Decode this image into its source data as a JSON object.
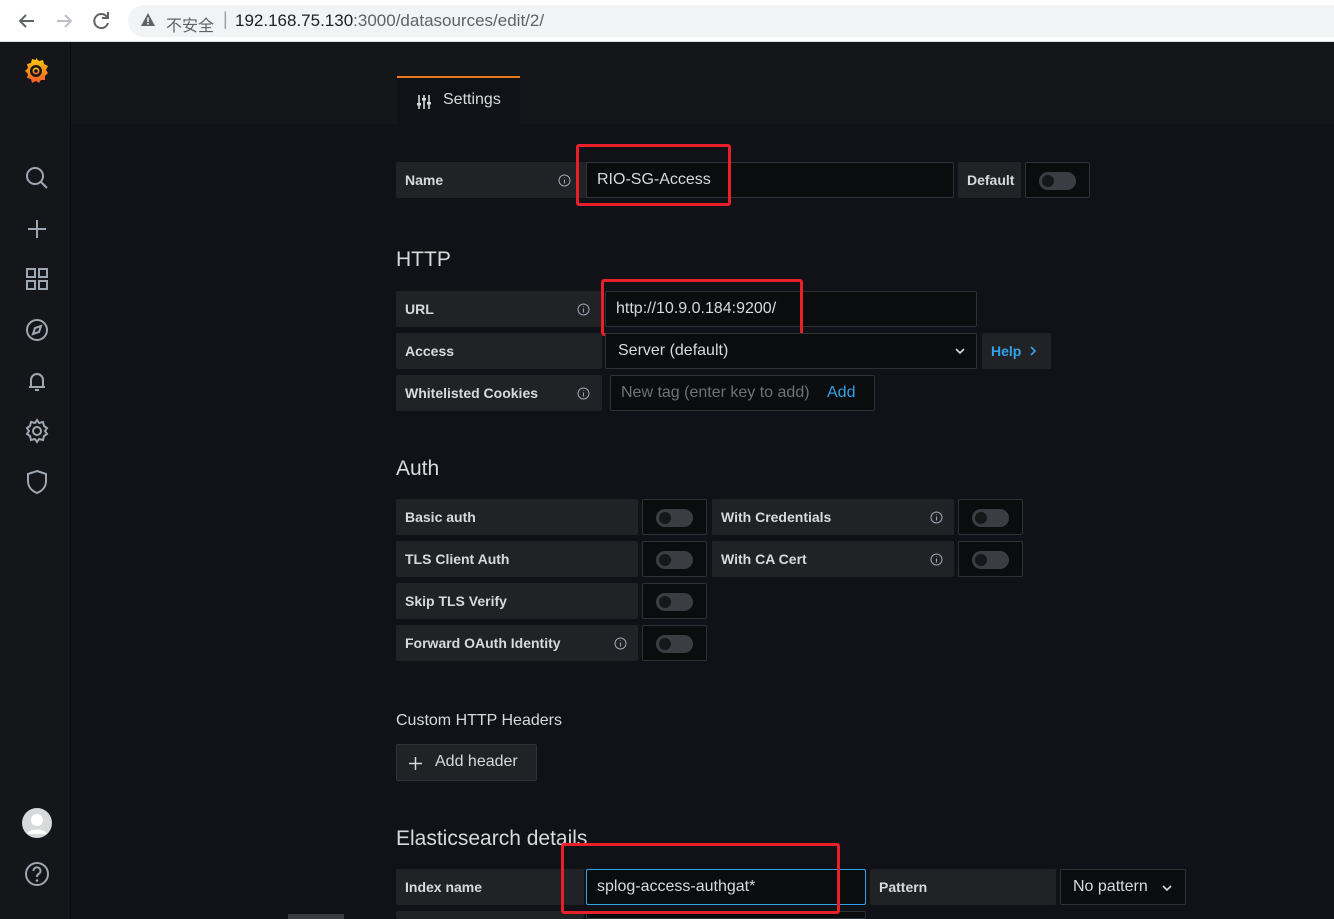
{
  "browser": {
    "insecure_label": "不安全",
    "url_host": "192.168.75.130",
    "url_path": ":3000/datasources/edit/2/"
  },
  "tab": {
    "label": "Settings"
  },
  "name_row": {
    "label": "Name",
    "value": "RIO-SG-Access",
    "default_label": "Default",
    "default_on": false
  },
  "http": {
    "title": "HTTP",
    "url_label": "URL",
    "url_value": "http://10.9.0.184:9200/",
    "access_label": "Access",
    "access_value": "Server (default)",
    "help_label": "Help",
    "cookies_label": "Whitelisted Cookies",
    "cookies_placeholder": "New tag (enter key to add)",
    "cookies_add": "Add"
  },
  "auth": {
    "title": "Auth",
    "basic_auth": "Basic auth",
    "with_credentials": "With Credentials",
    "tls_client_auth": "TLS Client Auth",
    "with_ca_cert": "With CA Cert",
    "skip_tls_verify": "Skip TLS Verify",
    "forward_oauth": "Forward OAuth Identity"
  },
  "headers": {
    "title": "Custom HTTP Headers",
    "add_header": "Add header"
  },
  "elastic": {
    "title": "Elasticsearch details",
    "index_label": "Index name",
    "index_value": "splog-access-authgat*",
    "pattern_label": "Pattern",
    "pattern_value": "No pattern"
  },
  "colors": {
    "accent": "#eb7b18",
    "highlight": "#e8202a",
    "link": "#33a2e5"
  }
}
